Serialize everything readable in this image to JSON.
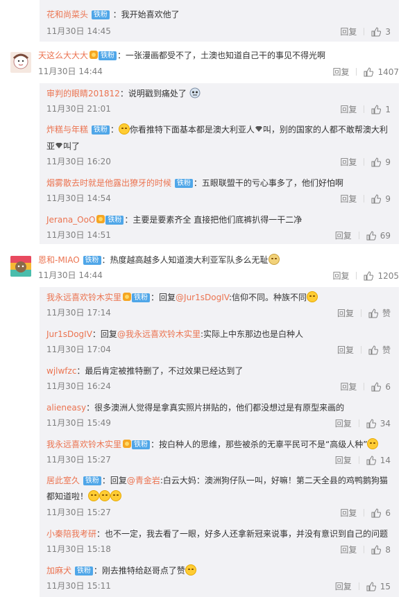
{
  "actions": {
    "reply": "回复",
    "like": "赞"
  },
  "badge_fan": "铁粉",
  "c0": {
    "user": "花和尚菜头",
    "text": "：我开始喜欢他了",
    "time": "11月30日 14:45",
    "likes": "3"
  },
  "c1": {
    "user": "天这么大大大",
    "text": "：一张漫画都受不了，土澳也知道自己干的事见不得光啊",
    "time": "11月30日 14:44",
    "likes": "1407"
  },
  "c1r": [
    {
      "user": "审判的眼睛201812",
      "text": "：说明戳到痛处了",
      "time": "11月30日 21:01",
      "likes": "1"
    },
    {
      "user": "炸糕与年糕",
      "text1": "你看推特下面基本都是澳大利亚人",
      "text1b": "叫，别的国家的人都不敢帮澳大利",
      "text2a": "亚",
      "text2b": "叫了",
      "time": "11月30日 16:20",
      "likes": "9"
    },
    {
      "user": "烟雾散去时就是他露出獠牙的时候",
      "text": "：五眼联盟干的亏心事多了，他们好怕啊",
      "time": "11月30日 14:54",
      "likes": "9"
    },
    {
      "user": "Jerana_OoO",
      "text": "：主要是要素齐全 直接把他们底裤扒得一干二净",
      "time": "11月30日 14:51",
      "likes": "69"
    }
  ],
  "c2": {
    "user": "恩和-MIAO",
    "text": "：热度越高越多人知道澳大利亚军队多么无耻",
    "time": "11月30日 14:44",
    "likes": "1205"
  },
  "c2r": [
    {
      "user": "我永远喜欢铃木实里",
      "pre": "：回复",
      "mention": "@Jur1sDogIV",
      "text": ":信仰不同。种族不同",
      "time": "11月30日 17:14",
      "likes": "赞"
    },
    {
      "user": "Jur1sDogIV",
      "pre": "：回复",
      "mention": "@我永远喜欢铃木实里",
      "text": ":实际上中东那边也是白种人",
      "time": "11月30日 17:04",
      "likes": "赞"
    },
    {
      "user": "wjlwfzc",
      "text": "：最后肯定被推特删了，不过效果已经达到了",
      "time": "11月30日 16:24",
      "likes": "6"
    },
    {
      "user": "alieneasy",
      "text": "：很多澳洲人觉得是拿真实照片拼贴的，他们都没想过是有原型来画的",
      "time": "11月30日 15:49",
      "likes": "34"
    },
    {
      "user": "我永远喜欢铃木实里",
      "text": "：按白种人的思维，那些被杀的无辜平民可不是“高级人种”",
      "time": "11月30日 15:27",
      "likes": "14"
    },
    {
      "user": "居此室久",
      "pre": "：回复",
      "mention": "@青金岩",
      "text": ":白云大妈：澳洲狗仔队一叫，好嘛！第二天全县的鸡鸭鹅狗猫",
      "text2": "都知道啦！",
      "time": "11月30日 15:27",
      "likes": "6"
    },
    {
      "user": "小秦陪我考研",
      "text": "：也不一定，我去看了一眼，好多人还拿新冠来说事，并没有意识到自己的问题",
      "time": "11月30日 15:18",
      "likes": "8"
    },
    {
      "user": "加麻犬",
      "text": "：刚去推特给赵哥点了赞",
      "time": "11月30日 15:11",
      "likes": "15"
    }
  ],
  "colors": {
    "username": "#eb7350",
    "badge": "#4fa6e8",
    "subbg": "#f2f2f5",
    "muted": "#808080"
  }
}
